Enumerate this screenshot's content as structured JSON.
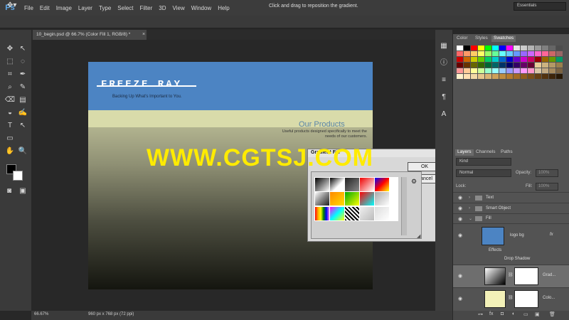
{
  "app": {
    "logo": "Ps"
  },
  "menu": [
    "File",
    "Edit",
    "Image",
    "Layer",
    "Type",
    "Select",
    "Filter",
    "3D",
    "View",
    "Window",
    "Help"
  ],
  "window_controls": [
    "–",
    "□",
    "✕"
  ],
  "options_bar": {
    "hint": "Click and drag to reposition the gradient.",
    "workspace": "Essentials"
  },
  "document": {
    "tab_title": "10_begin.psd @ 66.7% (Color Fill 1, RGB/8) *",
    "close": "×"
  },
  "canvas_content": {
    "brand": "FREEZE RAY",
    "tagline": "Backing Up What's Important to You.",
    "products_title": "Our Products",
    "products_desc": "Useful products designed specifically to meet the needs of our customers."
  },
  "gradient_dialog": {
    "title": "Gradient Fill",
    "ok": "OK",
    "cancel": "Cancel",
    "gear": "⚙",
    "close": "✕",
    "presets": [
      "linear-gradient(135deg,#000,#fff)",
      "linear-gradient(135deg,#000,#fff 60%,#fff0)",
      "linear-gradient(135deg,#222,#888)",
      "linear-gradient(135deg,#e00,#fff)",
      "linear-gradient(135deg,#00f,#f00,#ff0)",
      "linear-gradient(135deg,#fff,#888,#222)",
      "linear-gradient(135deg,#f80,#fd0)",
      "linear-gradient(135deg,#0a0,#ff0)",
      "linear-gradient(135deg,#f00,#0ff)",
      "linear-gradient(135deg,#aaa,#fff)",
      "linear-gradient(90deg,red,orange,yellow,green,blue,violet)",
      "linear-gradient(135deg,#f0f,#0ff,#ff0)",
      "repeating-linear-gradient(45deg,#000 0 2px,#fff 2px 4px)",
      "linear-gradient(135deg,#eee,#bbb)",
      "linear-gradient(135deg,#ddd,#fff)"
    ]
  },
  "watermark": "WWW.CGTSJ.COM",
  "status": {
    "zoom": "66.67%",
    "doc_info": "960 px x 768 px (72 ppi)"
  },
  "swatch_panel": {
    "tabs": [
      "Color",
      "Styles",
      "Swatches"
    ],
    "colors": [
      "#ffffff",
      "#000000",
      "#ff0000",
      "#ffff00",
      "#00ff00",
      "#00ffff",
      "#0000ff",
      "#ff00ff",
      "#e6e6e6",
      "#cccccc",
      "#b3b3b3",
      "#999999",
      "#808080",
      "#666666",
      "#4d4d4d",
      "#ff6666",
      "#ff9966",
      "#ffcc66",
      "#ffff66",
      "#99ff66",
      "#66ff99",
      "#66ffff",
      "#66ccff",
      "#6699ff",
      "#9966ff",
      "#cc66ff",
      "#ff66cc",
      "#ff6699",
      "#cc6666",
      "#996666",
      "#cc0000",
      "#cc6600",
      "#cccc00",
      "#66cc00",
      "#00cc66",
      "#00cccc",
      "#0066cc",
      "#0000cc",
      "#6600cc",
      "#cc00cc",
      "#cc0066",
      "#990000",
      "#996600",
      "#669900",
      "#009966",
      "#660000",
      "#663300",
      "#666600",
      "#336600",
      "#006633",
      "#006666",
      "#003366",
      "#000066",
      "#330066",
      "#660066",
      "#660033",
      "#e6cc99",
      "#ccb380",
      "#b39966",
      "#99804d",
      "#ff9999",
      "#ffcc99",
      "#ffff99",
      "#ccff99",
      "#99ffcc",
      "#99ffff",
      "#99ccff",
      "#9999ff",
      "#cc99ff",
      "#ff99ff",
      "#ff99cc",
      "#d9c7a6",
      "#c2a982",
      "#a68a5e",
      "#7a6342",
      "#fff2cc",
      "#ffe0b3",
      "#f2d9a6",
      "#e6c68c",
      "#d9b373",
      "#cca05a",
      "#bf8c40",
      "#b37a2e",
      "#a36b26",
      "#8f5c1f",
      "#7a4d19",
      "#663f14",
      "#52320f",
      "#3d250a",
      "#291905"
    ],
    "side_icons": [
      "▦",
      "ⓘ",
      "≡",
      "¶",
      "A"
    ]
  },
  "layers_panel": {
    "tabs": [
      "Layers",
      "Channels",
      "Paths"
    ],
    "kind": "Kind",
    "blend": "Normal",
    "opacity_label": "Opacity:",
    "opacity": "100%",
    "lock_label": "Lock:",
    "fill_label": "Fill:",
    "fill": "100%",
    "layers": [
      {
        "name": "Text",
        "type": "group"
      },
      {
        "name": "Smart Object",
        "type": "group"
      },
      {
        "name": "Fill",
        "type": "group"
      },
      {
        "name": "logo bg",
        "type": "layer",
        "fx": "fx"
      },
      {
        "name": "Effects",
        "type": "effects"
      },
      {
        "name": "Drop Shadow",
        "type": "effect"
      },
      {
        "name": "Grad...",
        "type": "fill"
      },
      {
        "name": "Colo...",
        "type": "fill"
      }
    ],
    "footer_icons": [
      "⊶",
      "fx",
      "◘",
      "◐",
      "▭",
      "▣",
      "🗑"
    ]
  },
  "toolbar": {
    "tools": [
      "✥",
      "⬚",
      "◌",
      "⌗",
      "✒",
      "⌕",
      "✎",
      "⌫",
      "▤",
      "◒",
      "✍",
      "T",
      "↖",
      "▭",
      "✋",
      "🔍"
    ]
  }
}
